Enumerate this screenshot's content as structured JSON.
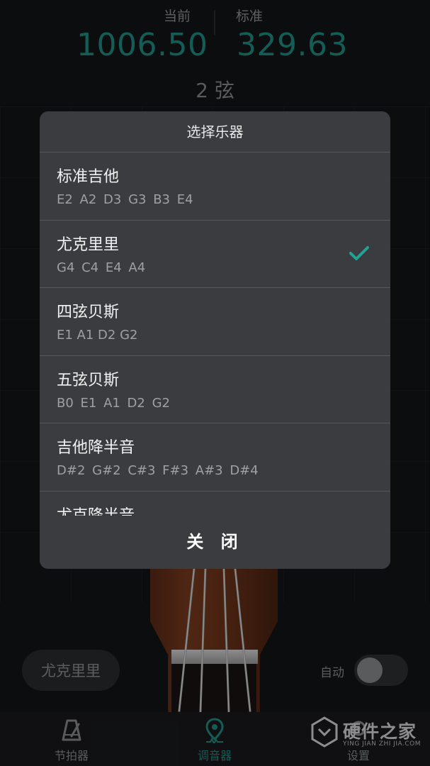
{
  "tuner": {
    "current_label": "当前",
    "current_value": "1006.50",
    "standard_label": "标准",
    "standard_value": "329.63",
    "string_label": "2 弦",
    "instrument_pill": "尤克里里",
    "auto_label": "自动",
    "auto_enabled": false
  },
  "dialog": {
    "title": "选择乐器",
    "close_label": "关 闭",
    "items": [
      {
        "name": "标准吉他",
        "notes": "E2 A2 D3 G3 B3 E4",
        "selected": false
      },
      {
        "name": "尤克里里",
        "notes": "G4 C4 E4 A4",
        "selected": true
      },
      {
        "name": "四弦贝斯",
        "notes": "E1 A1 D2 G2",
        "selected": false
      },
      {
        "name": "五弦贝斯",
        "notes": "B0 E1 A1 D2 G2",
        "selected": false
      },
      {
        "name": "吉他降半音",
        "notes": "D#2 G#2 C#3 F#3 A#3 D#4",
        "selected": false
      },
      {
        "name": "尤克降半音",
        "notes": "",
        "selected": false
      }
    ]
  },
  "bottom_nav": {
    "items": [
      {
        "label": "节拍器",
        "icon": "metronome-icon"
      },
      {
        "label": "调音器",
        "icon": "tuner-pin-icon",
        "active": true
      },
      {
        "label": "设置",
        "icon": "gear-icon"
      }
    ]
  },
  "watermark": {
    "title": "硬件之家",
    "subtitle": "YING JIAN ZHI JIA.COM"
  },
  "colors": {
    "accent": "#1d8f84",
    "dialog_bg": "#3a3c3f",
    "page_bg": "#131416"
  }
}
